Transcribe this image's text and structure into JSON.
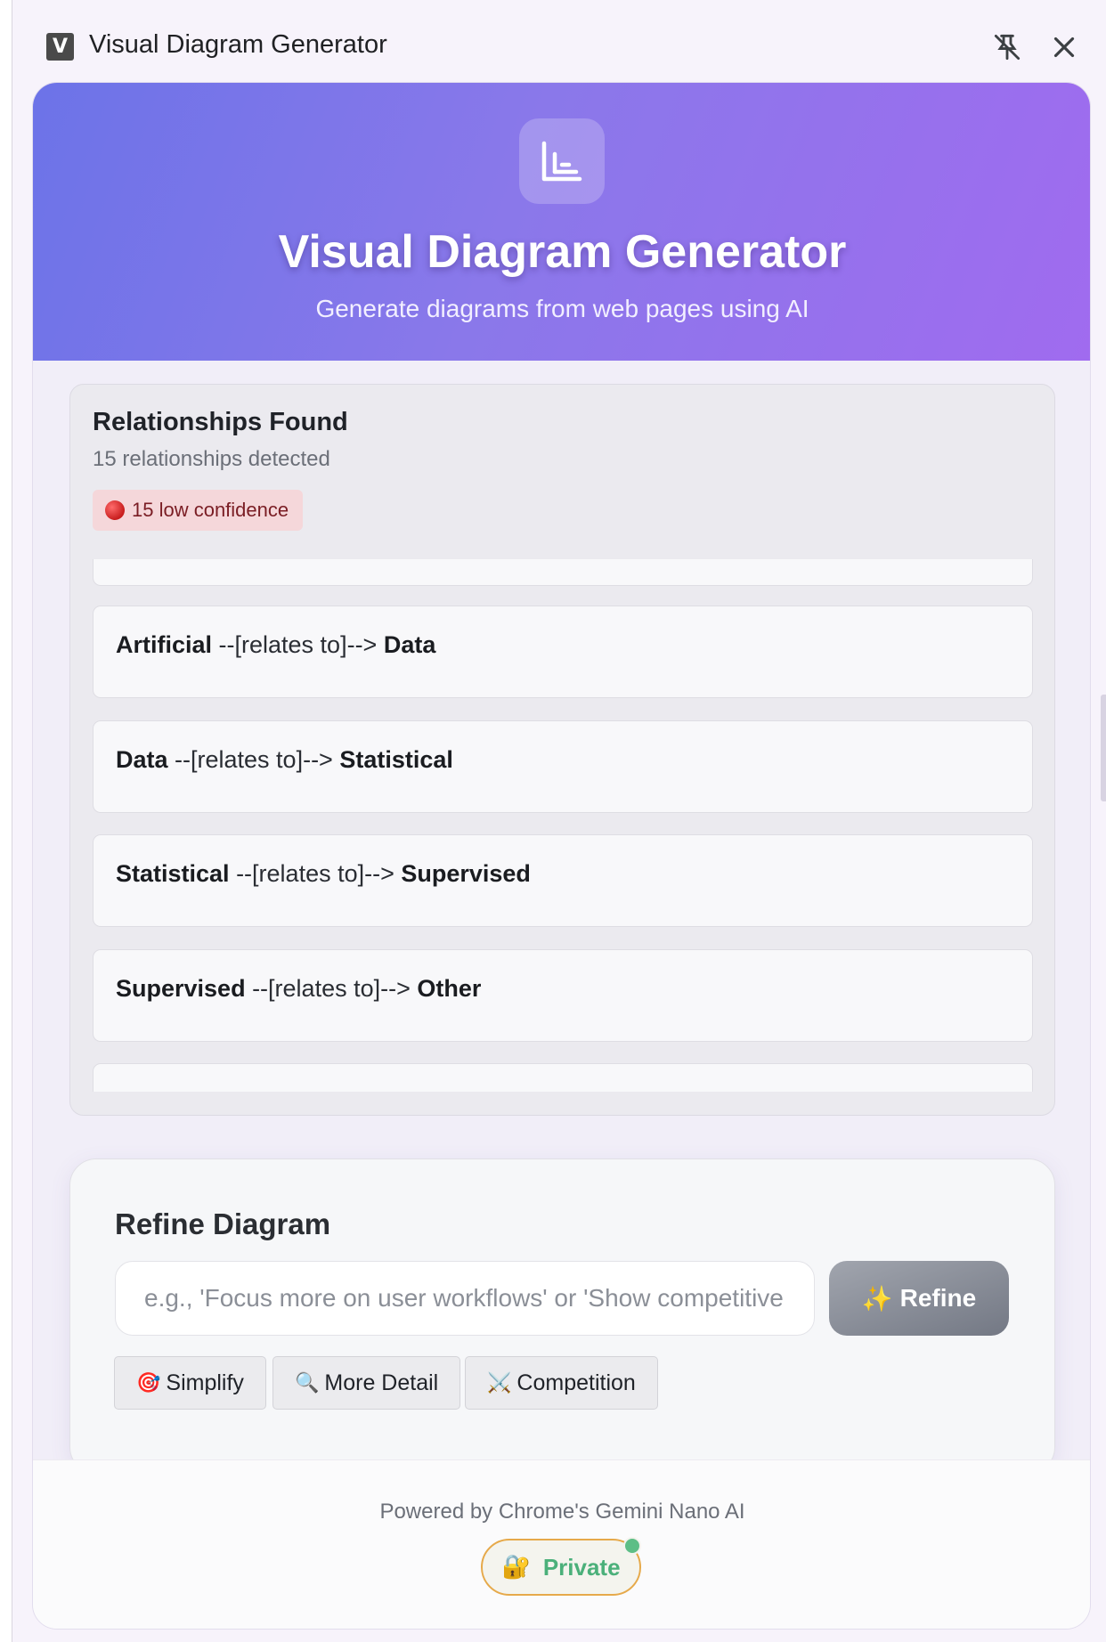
{
  "window": {
    "badge_letter": "V",
    "title": "Visual Diagram Generator",
    "pin_icon": "unpin-icon",
    "close_icon": "close-icon"
  },
  "hero": {
    "icon": "chart-icon",
    "title": "Visual Diagram Generator",
    "subtitle": "Generate diagrams from web pages using AI",
    "gradient_start": "#6c73e8",
    "gradient_end": "#a06bef"
  },
  "relationships": {
    "title": "Relationships Found",
    "count_text": "15 relationships detected",
    "badge_text": "15 low confidence",
    "badge_color": "#f5d7da",
    "items": [
      {
        "source": "Artificial",
        "relation": " --[relates to]--> ",
        "target": "Data"
      },
      {
        "source": "Data",
        "relation": " --[relates to]--> ",
        "target": "Statistical"
      },
      {
        "source": "Statistical",
        "relation": " --[relates to]--> ",
        "target": "Supervised"
      },
      {
        "source": "Supervised",
        "relation": " --[relates to]--> ",
        "target": "Other"
      }
    ]
  },
  "refine": {
    "title": "Refine Diagram",
    "input_placeholder": "e.g., 'Focus more on user workflows' or 'Show competitive",
    "input_value": "",
    "button_icon": "✨",
    "button_label": "Refine",
    "quick_actions": [
      {
        "icon": "🎯",
        "label": "Simplify"
      },
      {
        "icon": "🔍",
        "label": "More Detail"
      },
      {
        "icon": "⚔️",
        "label": "Competition"
      }
    ]
  },
  "footer": {
    "powered_by": "Powered by Chrome's Gemini Nano AI",
    "private_icon": "🔐",
    "private_label": "Private",
    "status_color": "#5dbe86"
  }
}
